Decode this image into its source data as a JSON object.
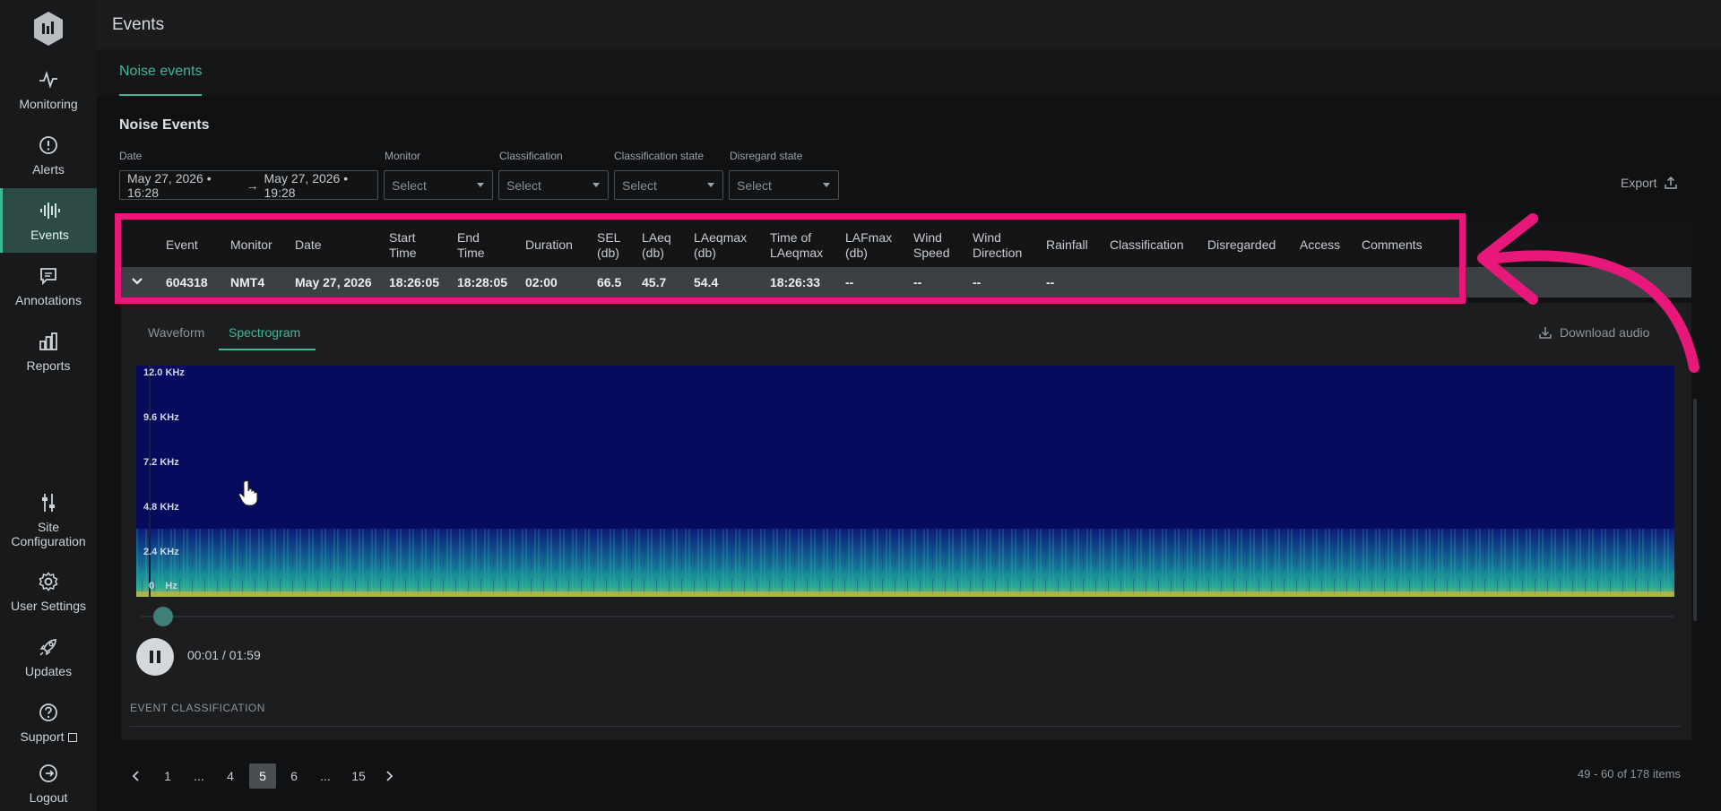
{
  "sidebar": {
    "items": [
      {
        "label": "Monitoring",
        "icon": "pulse-icon"
      },
      {
        "label": "Alerts",
        "icon": "alert-circle-icon"
      },
      {
        "label": "Events",
        "icon": "sound-wave-icon"
      },
      {
        "label": "Annotations",
        "icon": "chat-icon"
      },
      {
        "label": "Reports",
        "icon": "bar-chart-icon"
      },
      {
        "label": "Site Configuration",
        "icon": "sliders-icon"
      },
      {
        "label": "User Settings",
        "icon": "gear-icon"
      },
      {
        "label": "Updates",
        "icon": "rocket-icon"
      },
      {
        "label": "Support",
        "icon": "help-circle-icon"
      },
      {
        "label": "Logout",
        "icon": "logout-icon"
      }
    ],
    "active": "Events"
  },
  "header": {
    "title": "Events"
  },
  "tabs": {
    "active": "Noise events"
  },
  "section": {
    "title": "Noise Events"
  },
  "filters": {
    "date_label": "Date",
    "date_from": "May 27, 2026 • 16:28",
    "date_to": "May 27, 2026 • 19:28",
    "monitor_label": "Monitor",
    "monitor_value": "Select",
    "classification_label": "Classification",
    "classification_value": "Select",
    "classification_state_label": "Classification state",
    "classification_state_value": "Select",
    "disregard_state_label": "Disregard state",
    "disregard_state_value": "Select"
  },
  "export_label": "Export",
  "table": {
    "headers": {
      "event": "Event",
      "monitor": "Monitor",
      "date": "Date",
      "start_time_1": "Start",
      "start_time_2": "Time",
      "end_time_1": "End",
      "end_time_2": "Time",
      "duration": "Duration",
      "sel_1": "SEL",
      "sel_2": "(db)",
      "laeq_1": "LAeq",
      "laeq_2": "(db)",
      "laeqmax_1": "LAeqmax",
      "laeqmax_2": "(db)",
      "time_laeqmax_1": "Time of",
      "time_laeqmax_2": "LAeqmax",
      "lafmax_1": "LAFmax",
      "lafmax_2": "(db)",
      "wind_speed_1": "Wind",
      "wind_speed_2": "Speed",
      "wind_dir_1": "Wind",
      "wind_dir_2": "Direction",
      "rainfall": "Rainfall",
      "classification": "Classification",
      "disregarded": "Disregarded",
      "access": "Access",
      "comments": "Comments"
    },
    "row": {
      "event": "604318",
      "monitor": "NMT4",
      "date": "May 27, 2026",
      "start_time": "18:26:05",
      "end_time": "18:28:05",
      "duration": "02:00",
      "sel": "66.5",
      "laeq": "45.7",
      "laeqmax": "54.4",
      "time_laeqmax": "18:26:33",
      "lafmax": "--",
      "wind_speed": "--",
      "wind_dir": "--",
      "rainfall": "--"
    }
  },
  "panel": {
    "tab_waveform": "Waveform",
    "tab_spectrogram": "Spectrogram",
    "active_tab": "Spectrogram",
    "download_label": "Download audio",
    "freq_labels": [
      "12.0 KHz",
      "9.6 KHz",
      "7.2 KHz",
      "4.8 KHz",
      "2.4 KHz",
      "0    Hz"
    ],
    "time": "00:01 / 01:59",
    "playback_position": 0.008,
    "event_classification_title": "EVENT CLASSIFICATION"
  },
  "pagination": {
    "pages": [
      "1",
      "...",
      "4",
      "5",
      "6",
      "...",
      "15"
    ],
    "current": "5",
    "items_text": "49 - 60 of 178 items"
  },
  "colors": {
    "accent": "#3fb89a",
    "highlight": "#e8187a",
    "spectro_bg": "#070b5e"
  }
}
